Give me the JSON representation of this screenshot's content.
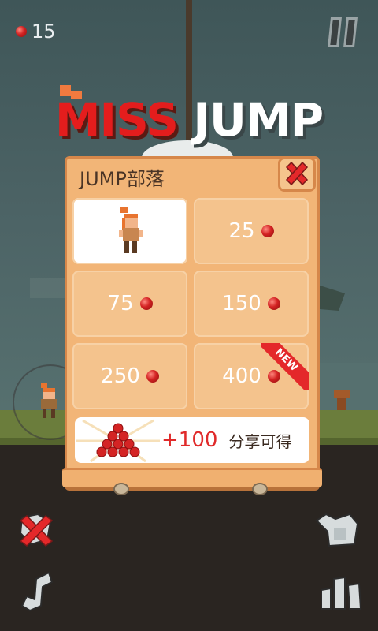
{
  "hud": {
    "coin_count": "15",
    "coin_icon": "red-gem-icon",
    "pause_icon": "pause-icon"
  },
  "title": {
    "word1": "MISS",
    "word2": "JUMP"
  },
  "shop": {
    "title": "JUMP部落",
    "close_icon": "close-x-icon",
    "items": [
      {
        "price": "",
        "selected": true,
        "character": "girl-character"
      },
      {
        "price": "25",
        "selected": false
      },
      {
        "price": "75",
        "selected": false
      },
      {
        "price": "150",
        "selected": false
      },
      {
        "price": "250",
        "selected": false
      },
      {
        "price": "400",
        "selected": false,
        "badge": "NEW"
      }
    ],
    "share": {
      "amount": "+100",
      "label": "分享可得",
      "icon": "gem-pile-icon"
    }
  },
  "colors": {
    "accent_red": "#e41d1d",
    "panel": "#f2b577",
    "panel_border": "#d6874a"
  },
  "bottom_icons": [
    "no-ads-icon",
    "music-note-icon",
    "rate-icon",
    "leaderboard-icon"
  ]
}
